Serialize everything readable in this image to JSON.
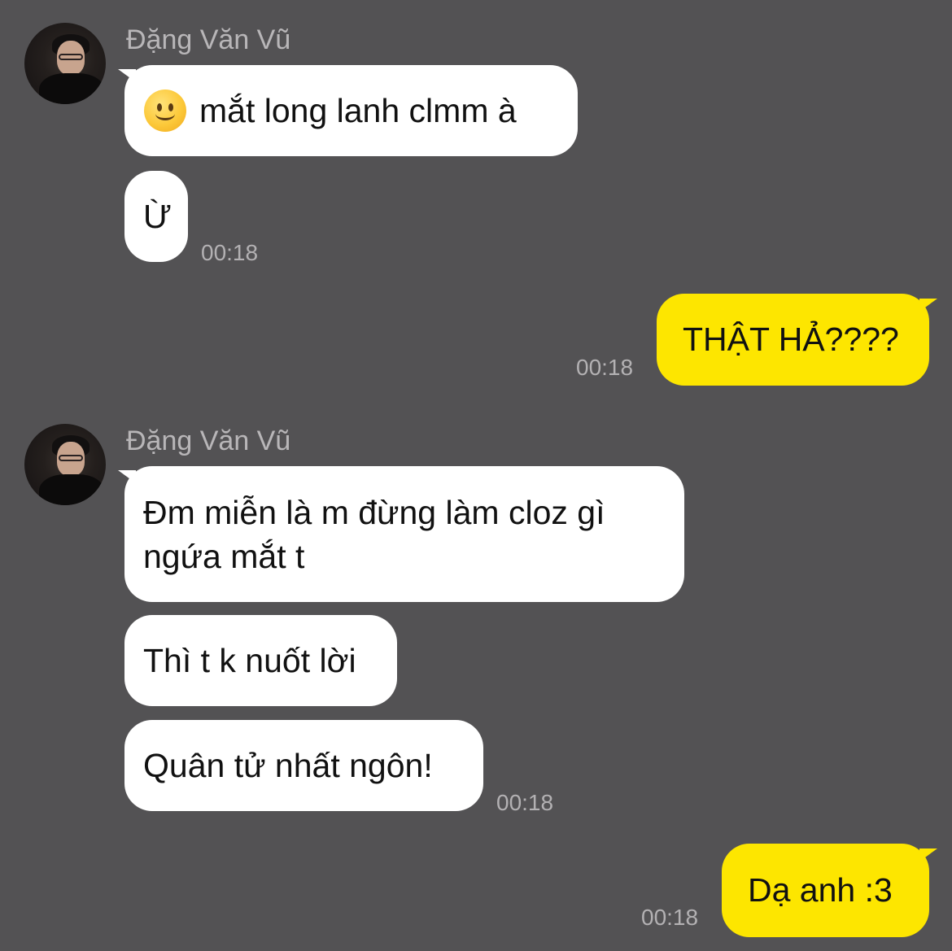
{
  "chat": {
    "messages": [
      {
        "sender_name": "Đặng Văn Vũ",
        "avatar_icon": "contact-avatar",
        "bubbles": [
          {
            "emoji": "slightly-smiling-face-icon",
            "text": "mắt long lanh clmm à"
          },
          {
            "text": "Ừ",
            "time": "00:18"
          }
        ]
      },
      {
        "outgoing": true,
        "bubbles": [
          {
            "text": "THẬT HẢ????",
            "time": "00:18"
          }
        ]
      },
      {
        "sender_name": "Đặng Văn Vũ",
        "avatar_icon": "contact-avatar",
        "bubbles": [
          {
            "text": "Đm miễn là m đừng làm cloz gì ngứa mắt t"
          },
          {
            "text": "Thì t k nuốt lời"
          },
          {
            "text": "Quân tử nhất ngôn!",
            "time": "00:18"
          }
        ]
      },
      {
        "outgoing": true,
        "bubbles": [
          {
            "text": "Dạ anh :3",
            "time": "00:18"
          }
        ]
      }
    ]
  },
  "colors": {
    "background": "#535254",
    "incoming_bubble": "#ffffff",
    "outgoing_bubble": "#fde600",
    "sender_name": "#b8b6b8",
    "timestamp": "#b3b1b3"
  }
}
